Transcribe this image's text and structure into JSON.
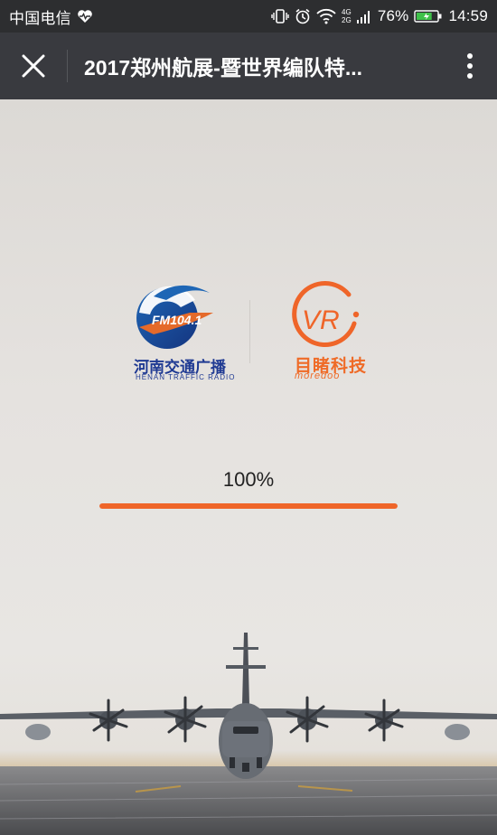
{
  "status_bar": {
    "carrier": "中国电信",
    "battery_percent": "76%",
    "battery_level": 0.76,
    "time": "14:59",
    "network": "4G",
    "network_sub": "2G",
    "icons": [
      "heart-pulse-icon",
      "vibrate-icon",
      "alarm-icon",
      "wifi-icon",
      "signal-icon",
      "battery-icon"
    ]
  },
  "title_bar": {
    "title": "2017郑州航展-暨世界编队特...",
    "close_icon": "close-icon",
    "more_icon": "more-vertical-icon"
  },
  "logos": {
    "henan": {
      "badge_text": "FM104.1",
      "name_cn": "河南交通广播",
      "name_en": "HENAN TRAFFIC RADIO"
    },
    "moredoo": {
      "badge_text": "VR",
      "name_cn": "目睹科技",
      "name_en": "moredoo"
    }
  },
  "loading": {
    "percent_text": "100%",
    "progress": 1.0
  },
  "colors": {
    "status_bg": "#2d2e30",
    "title_bg": "#393a3f",
    "accent_orange": "#ef6529",
    "henan_blue": "#1f3a93",
    "battery_green": "#3fc14a"
  }
}
